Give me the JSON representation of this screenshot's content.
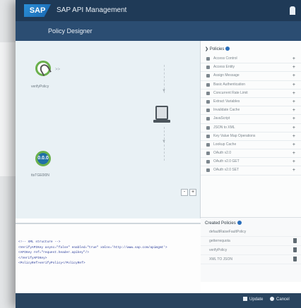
{
  "shell": {
    "logo": "SAP",
    "product": "SAP API Management",
    "user_icon": "user-icon"
  },
  "subheader": {
    "title": "Policy Designer"
  },
  "canvas": {
    "proxy_endpoint_label": "verifyPolicy",
    "target_endpoint_text": "0.0.0",
    "target_endpoint_label": "ttsTGE0l0N",
    "flow_arrow": ">>",
    "zoom_in": "+",
    "zoom_out": "-"
  },
  "policies": {
    "heading": "Policies",
    "items": [
      {
        "label": "Access Control",
        "icon": "access-icon"
      },
      {
        "label": "Access Entity",
        "icon": "entity-icon"
      },
      {
        "label": "Assign Message",
        "icon": "assign-icon"
      },
      {
        "label": "Basic Authentication",
        "icon": "basic-auth-icon"
      },
      {
        "label": "Concurrent Rate Limit",
        "icon": "rate-limit-icon"
      },
      {
        "label": "Extract Variables",
        "icon": "extract-icon"
      },
      {
        "label": "Invalidate Cache",
        "icon": "cache-icon"
      },
      {
        "label": "JavaScript",
        "icon": "javascript-icon"
      },
      {
        "label": "JSON to XML",
        "icon": "json-xml-icon"
      },
      {
        "label": "Key Value Map Operations",
        "icon": "key-value-icon"
      },
      {
        "label": "Lookup Cache",
        "icon": "lookup-icon"
      },
      {
        "label": "OAuth v2.0",
        "icon": "oauth-icon"
      },
      {
        "label": "OAuth v2.0 GET",
        "icon": "oauth-get-icon"
      },
      {
        "label": "OAuth v2.0 SET",
        "icon": "oauth-set-icon"
      }
    ],
    "add_label": "+"
  },
  "created_policies": {
    "heading": "Created Policies",
    "items": [
      {
        "label": "defaultRaiseFaultPolicy",
        "deletable": false
      },
      {
        "label": "getterrequota",
        "deletable": true
      },
      {
        "label": "verifyPolicy",
        "deletable": true
      },
      {
        "label": "XML TO JSON",
        "deletable": true
      }
    ]
  },
  "editor": {
    "lines": [
      "<!-- XML structure -->",
      "<VerifyAPIKey async=\"false\" enabled=\"true\" xmlns='http://www.sap.com/apimgmt'>",
      "",
      "  <APIKey ref=\"request.header.apikey\"/>",
      "</VerifyAPIKey>",
      "",
      "<PolicyRef>verifyPolicy</PolicyRef>"
    ]
  },
  "footer": {
    "update_label": "Update",
    "cancel_label": "Cancel"
  }
}
